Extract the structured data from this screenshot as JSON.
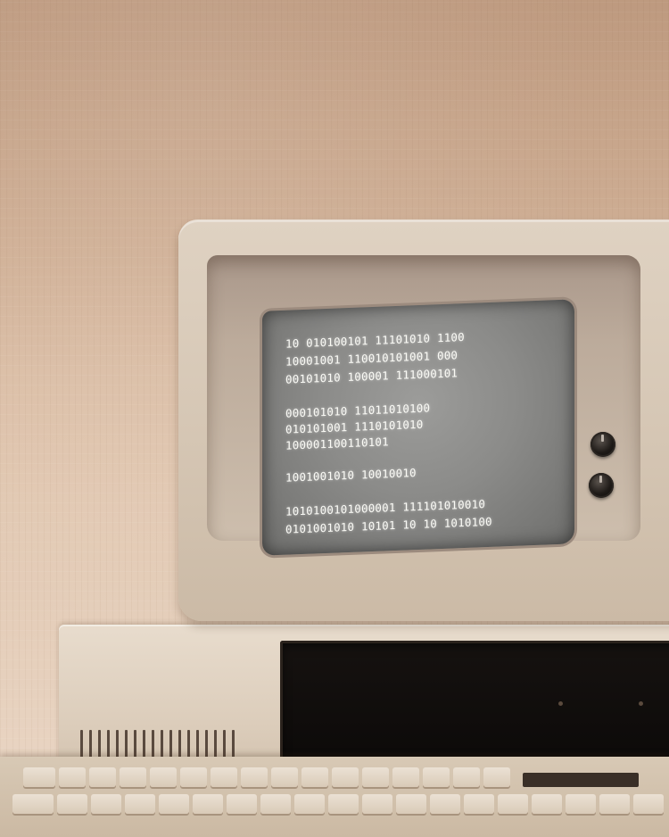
{
  "screen": {
    "lines": [
      "10 010100101 11101010 1100",
      "10001001 110010101001 000",
      "00101010 100001 111000101",
      "",
      "000101010 11011010100",
      "010101001 1110101010",
      "100001100110101",
      "",
      "1001001010 10010010",
      "",
      "1010100101000001 111101010010",
      "0101001010 10101 10 10 1010100"
    ]
  },
  "colors": {
    "wall": "#d4b49a",
    "case": "#dccdbb",
    "screen_text": "#fbfbf6",
    "screen_glass": "#8b8b89"
  }
}
